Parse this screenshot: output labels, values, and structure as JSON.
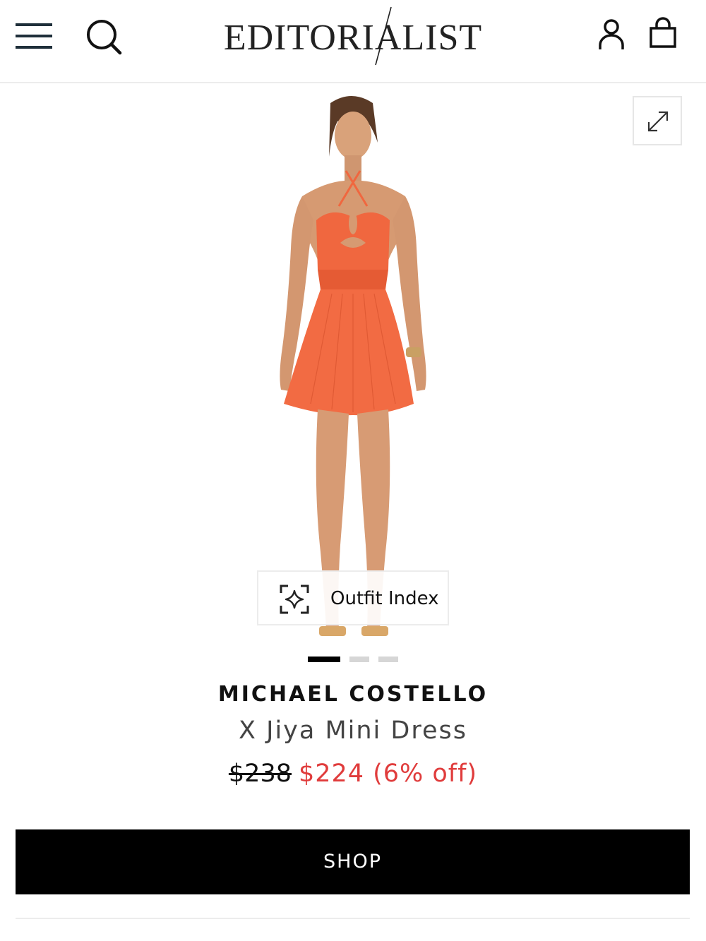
{
  "header": {
    "logo_text": "EDITORIALIST",
    "menu_icon": "hamburger-menu-icon",
    "search_icon": "search-icon",
    "account_icon": "user-account-icon",
    "bag_icon": "shopping-bag-icon"
  },
  "gallery": {
    "image_description_icon": "product-photo",
    "expand_icon": "expand-arrows-icon",
    "outfit_index_label": "Outfit Index",
    "outfit_index_icon": "sparkle-scan-icon",
    "dots": {
      "count": 3,
      "active_index": 0
    }
  },
  "product": {
    "brand": "MICHAEL COSTELLO",
    "name": "X Jiya Mini Dress",
    "original_price": "$238",
    "sale_price": "$224",
    "discount": "(6% off)"
  },
  "actions": {
    "shop_label": "SHOP"
  },
  "colors": {
    "sale_red": "#e03c3c",
    "dress_orange": "#f0673f",
    "button_black": "#000000"
  }
}
